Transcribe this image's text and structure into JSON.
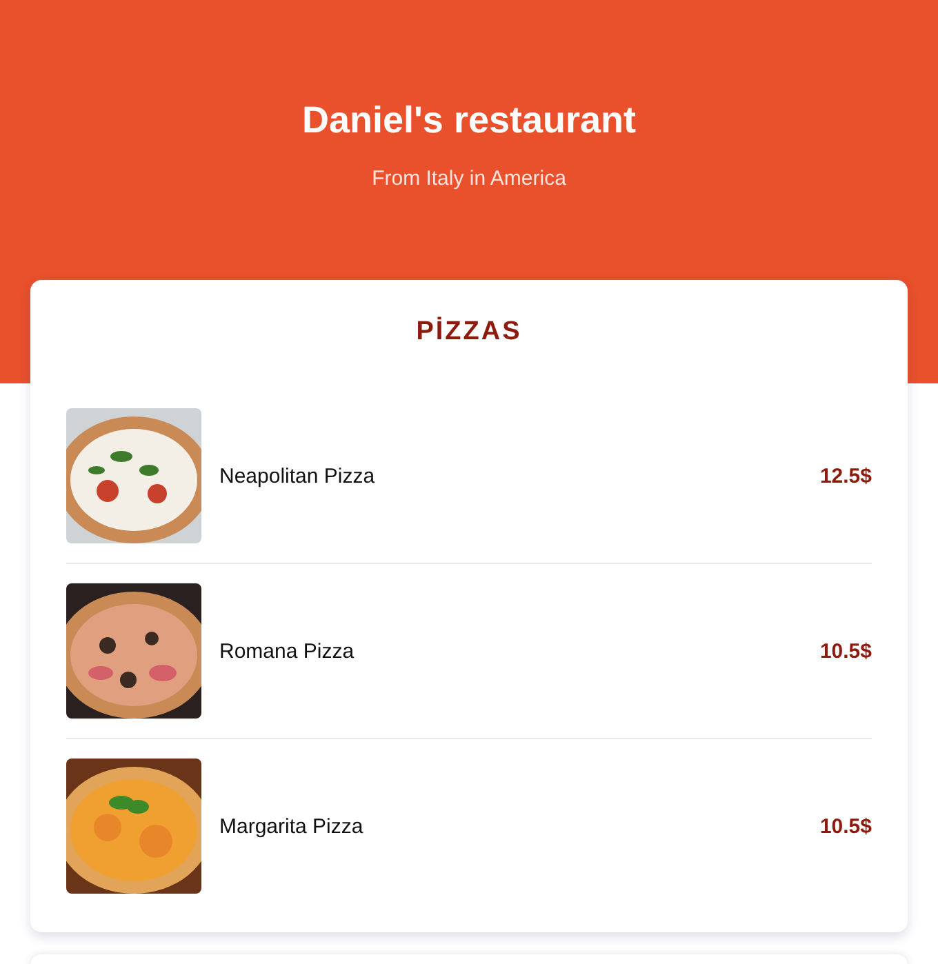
{
  "header": {
    "title": "Daniel's restaurant",
    "subtitle": "From Italy in America"
  },
  "section": {
    "title": "PİZZAS",
    "items": [
      {
        "name": "Neapolitan Pizza",
        "price": "12.5$"
      },
      {
        "name": "Romana Pizza",
        "price": "10.5$"
      },
      {
        "name": "Margarita Pizza",
        "price": "10.5$"
      }
    ]
  }
}
